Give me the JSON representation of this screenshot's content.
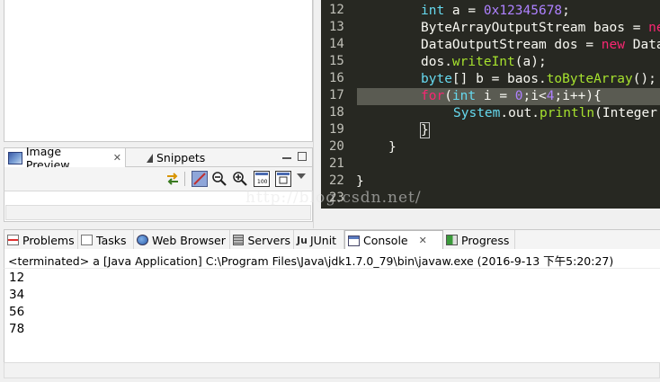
{
  "left_panel": {
    "tabs": [
      {
        "label": "Image Preview",
        "icon": "image-preview-icon",
        "close": "✕"
      },
      {
        "label": "Snippets",
        "icon": "snippets-icon"
      }
    ]
  },
  "editor": {
    "lines": [
      {
        "num": "12"
      },
      {
        "num": "13"
      },
      {
        "num": "14"
      },
      {
        "num": "15"
      },
      {
        "num": "16"
      },
      {
        "num": "17"
      },
      {
        "num": "18"
      },
      {
        "num": "19"
      },
      {
        "num": "20"
      },
      {
        "num": "21"
      },
      {
        "num": "22"
      },
      {
        "num": "23"
      }
    ],
    "watermark": "http://blog.csdn.net/"
  },
  "bottom_panel": {
    "tabs": [
      {
        "label": "Problems",
        "icon": "problems-icon"
      },
      {
        "label": "Tasks",
        "icon": "tasks-icon"
      },
      {
        "label": "Web Browser",
        "icon": "globe-icon"
      },
      {
        "label": "Servers",
        "icon": "servers-icon"
      },
      {
        "label": "JUnit",
        "icon": "junit-icon"
      },
      {
        "label": "Console",
        "icon": "console-icon",
        "close": "✕"
      },
      {
        "label": "Progress",
        "icon": "progress-icon"
      }
    ],
    "console_header": "<terminated> a [Java Application] C:\\Program Files\\Java\\jdk1.7.0_79\\bin\\javaw.exe (2016-9-13 下午5:20:27)",
    "output": [
      "12",
      "34",
      "56",
      "78"
    ]
  },
  "colors": {
    "editor_bg": "#272822",
    "keyword": "#f92672",
    "type": "#66d9ef",
    "number": "#ae81ff",
    "method": "#a6e22e"
  }
}
